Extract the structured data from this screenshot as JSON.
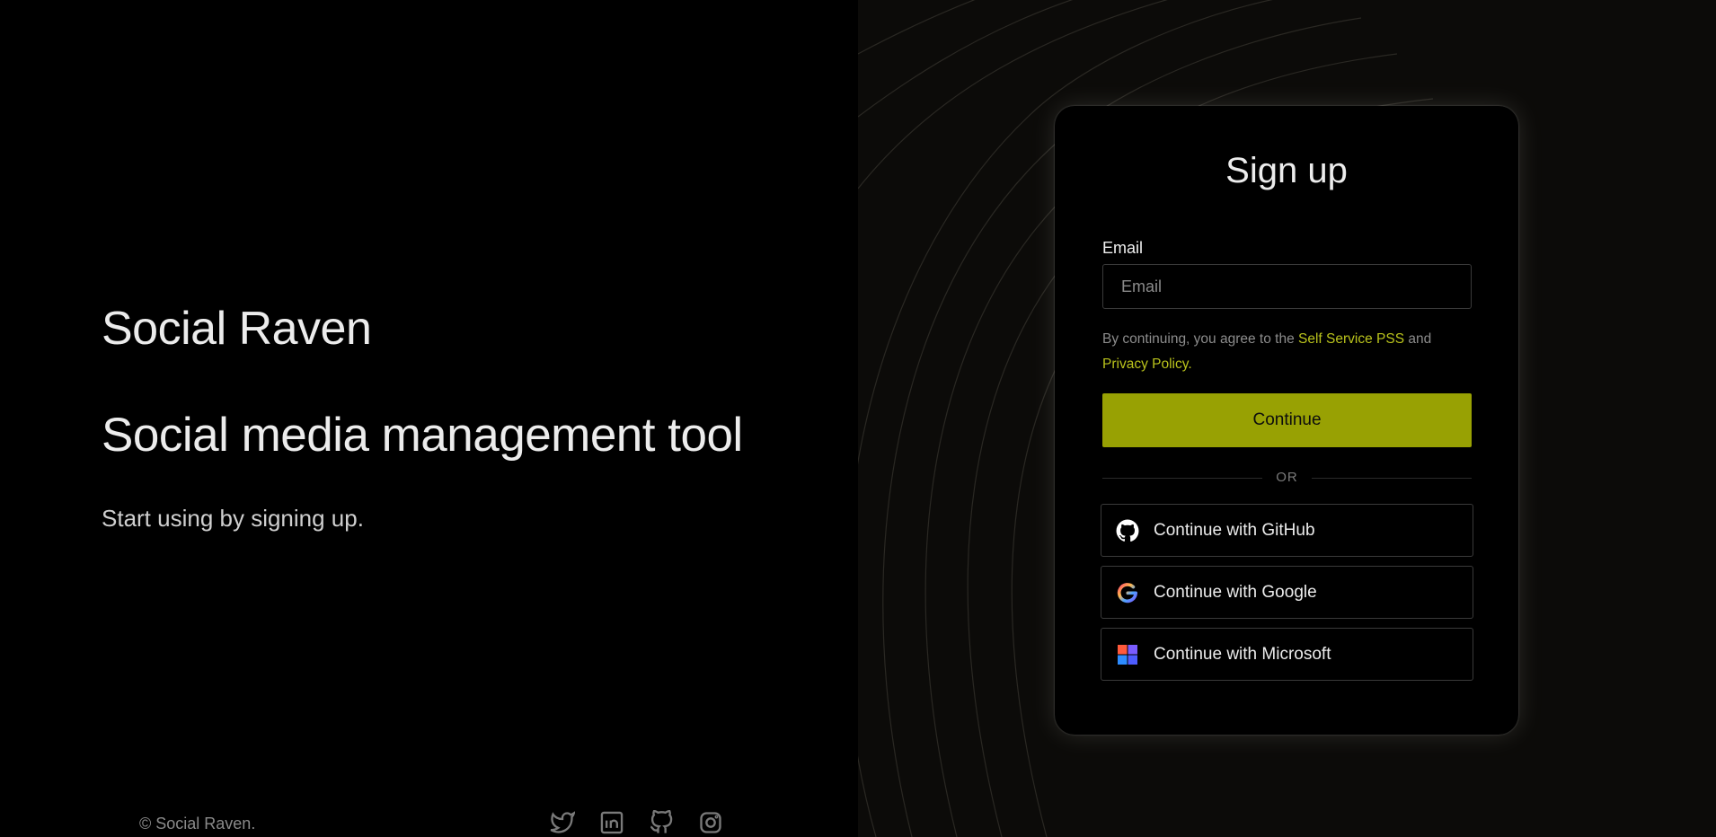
{
  "brand": {
    "title": "Social Raven",
    "tagline": "Social media management tool",
    "subtext": "Start using by signing up."
  },
  "footer": {
    "copyright": "© Social Raven.",
    "social_icons": [
      "twitter-icon",
      "linkedin-icon",
      "github-icon",
      "instagram-icon"
    ]
  },
  "signup": {
    "title": "Sign up",
    "email_label": "Email",
    "email_placeholder": "Email",
    "email_value": "",
    "terms_prefix": "By continuing, you agree to the ",
    "terms_link": "Self Service PSS",
    "terms_middle": " and ",
    "privacy_link": "Privacy Policy.",
    "continue_label": "Continue",
    "divider_label": "OR",
    "github_label": "Continue with GitHub",
    "google_label": "Continue with Google",
    "microsoft_label": "Continue with Microsoft"
  },
  "colors": {
    "accent": "#98a103",
    "link": "#b9c21c",
    "background_left": "#000000",
    "background_right": "#0c0b09"
  }
}
